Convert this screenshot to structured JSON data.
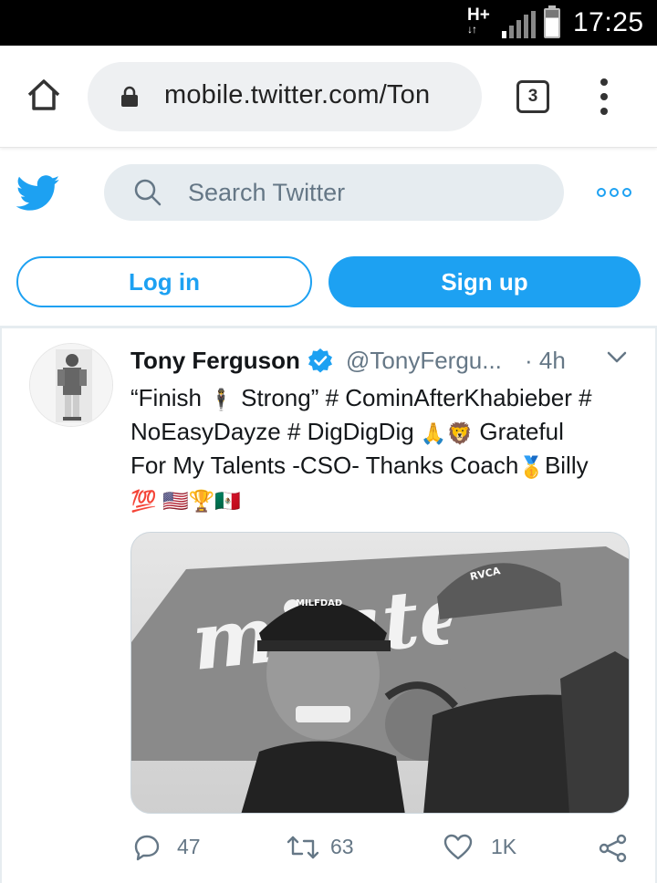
{
  "status_bar": {
    "network": "H+",
    "network_arrows": "↓↑",
    "time": "17:25",
    "icons": [
      "signal-icon",
      "battery-icon"
    ]
  },
  "browser": {
    "url": "mobile.twitter.com/Ton",
    "tab_count": "3",
    "icons": [
      "home-icon",
      "lock-icon",
      "menu-icon"
    ]
  },
  "twitter_header": {
    "search_placeholder": "Search Twitter",
    "icons": [
      "twitter-bird-icon",
      "search-icon",
      "more-icon"
    ]
  },
  "auth": {
    "login_label": "Log in",
    "signup_label": "Sign up"
  },
  "tweet": {
    "author_name": "Tony Ferguson",
    "handle": "@TonyFergu...",
    "time": "· 4h",
    "lines": [
      [
        "“Finish ",
        "🕴",
        " Strong” # CominAfterKhabieber #"
      ],
      [
        "NoEasyDayze # DigDigDig ",
        "🙏🦁",
        " Grateful"
      ],
      [
        "For My Talents -CSO- Thanks Coach",
        "🥇",
        "Billy"
      ],
      [
        "",
        "💯 🇺🇸🏆🇲🇽",
        ""
      ]
    ],
    "media_caption_left": "MILFDAD",
    "media_caption_right": "RVCA",
    "actions": {
      "replies": "47",
      "retweets": "63",
      "likes": "1K"
    },
    "colors": {
      "brand_blue": "#1da1f2",
      "text": "#14171a",
      "muted": "#657786"
    }
  }
}
